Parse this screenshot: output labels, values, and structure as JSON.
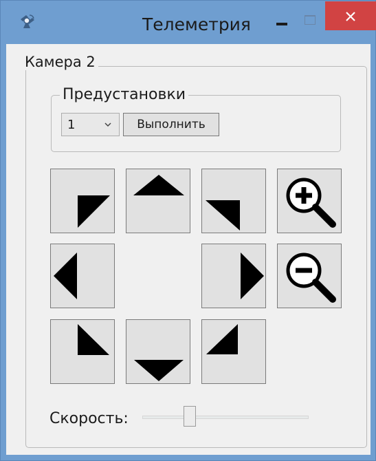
{
  "window": {
    "title": "Телеметрия",
    "icons": {
      "app": "satellite-app-icon",
      "minimize": "minimize-icon",
      "maximize": "maximize-icon",
      "close": "close-icon"
    },
    "colors": {
      "frame": "#6f9ed0",
      "close_button": "#d14343",
      "client": "#f0f0f0"
    }
  },
  "camera_group": {
    "legend": "Камера 2"
  },
  "presets": {
    "legend": "Предустановки",
    "selected": "1",
    "execute_label": "Выполнить"
  },
  "ptz": {
    "buttons": [
      {
        "id": "up-left",
        "icon": "arrow-up-left-icon"
      },
      {
        "id": "up",
        "icon": "arrow-up-icon"
      },
      {
        "id": "up-right",
        "icon": "arrow-up-right-icon"
      },
      {
        "id": "zoom-in",
        "icon": "zoom-in-icon"
      },
      {
        "id": "left",
        "icon": "arrow-left-icon"
      },
      {
        "id": "right",
        "icon": "arrow-right-icon"
      },
      {
        "id": "zoom-out",
        "icon": "zoom-out-icon"
      },
      {
        "id": "down-left",
        "icon": "arrow-down-left-icon"
      },
      {
        "id": "down",
        "icon": "arrow-down-icon"
      },
      {
        "id": "down-right",
        "icon": "arrow-down-right-icon"
      }
    ]
  },
  "speed": {
    "label": "Скорость:",
    "value_fraction": 0.27
  }
}
